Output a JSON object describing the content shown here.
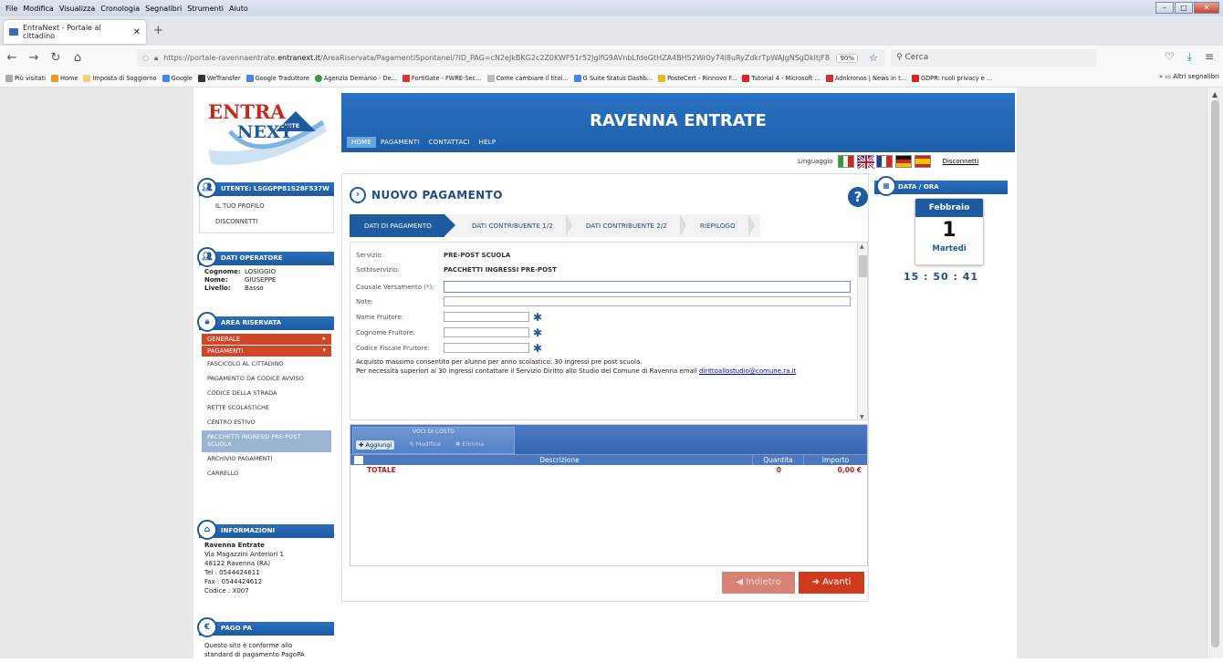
{
  "browser": {
    "menu": [
      "File",
      "Modifica",
      "Visualizza",
      "Cronologia",
      "Segnalibri",
      "Strumenti",
      "Aiuto"
    ],
    "tab_title": "EntraNext - Portale al cittadino",
    "url_prefix": "https://portale-ravennaentrate.",
    "url_domain": "entranext.it",
    "url_path": "/AreaRiservata/PagamentiSpontanei/?ID_PAG=cN2eJkBKG2c2Z0KWF51r52JglfG9AVnbLfdeGtHZA4BH52Wr0y74l8uRyZdkrTpWAJgNSgDkltjF8",
    "zoom": "90%",
    "search_placeholder": "Cerca",
    "bookmarks": [
      "Più visitati",
      "Home",
      "Imposta di Soggiorno",
      "Google",
      "WeTransfer",
      "Google Traduttore",
      "Agenzia Demanio - De...",
      "FortiGate - FWRE-Sec...",
      "Come cambiare il titol...",
      "G Suite Status Dashb...",
      "PosteCert - Rinnovo F...",
      "Tutorial 4 - Microsoft ...",
      "Adnkronos | News in t...",
      "GDPR: ruoli privacy e ..."
    ],
    "bookmarks_other": "Altri segnalibri"
  },
  "header": {
    "logo_line1": "ENTRA",
    "logo_suite": "SUITE",
    "logo_line2": "NEXT",
    "title": "RAVENNA ENTRATE",
    "menu": [
      "HOME",
      "PAGAMENTI",
      "CONTATTACI",
      "HELP"
    ],
    "language_label": "Linguaggio",
    "logout": "Disconnetti"
  },
  "sidebar": {
    "user_head": "UTENTE: LSGGPP81S28F537W",
    "user_links": [
      "IL TUO PROFILO",
      "DISCONNETTI"
    ],
    "operator_head": "DATI OPERATORE",
    "operator": [
      {
        "k": "Cognome:",
        "v": "LOSIGGIO"
      },
      {
        "k": "Nome:",
        "v": "GIUSEPPE"
      },
      {
        "k": "Livello:",
        "v": "Basso"
      }
    ],
    "reserved_head": "AREA RISERVATA",
    "sub_generale": "GENERALE",
    "sub_pagamenti": "PAGAMENTI",
    "items": [
      "FASCICOLO AL CITTADINO",
      "PAGAMENTO DA CODICE AVVISO",
      "CODICE DELLA STRADA",
      "RETTE SCOLASTICHE",
      "CENTRO ESTIVO",
      "PACCHETTI INGRESSI PRE-POST SCUOLA",
      "ARCHIVIO PAGAMENTI",
      "CARRELLO"
    ],
    "info_head": "INFORMAZIONI",
    "info_name": "Ravenna Entrate",
    "info_lines": [
      "Via Magazzini Anteriori 1",
      "48122 Ravenna (RA)",
      "Tel : 0544424611",
      "Fax : 0544424612",
      "Codice : X007"
    ],
    "pagopa_head": "PAGO PA",
    "pagopa_text1": "Questo sito è conforme allo",
    "pagopa_text2": "standard di pagamento PagoPA"
  },
  "main": {
    "title": "NUOVO PAGAMENTO",
    "help": "?",
    "steps": [
      "DATI DI PAGAMENTO",
      "DATI CONTRIBUENTE 1/2",
      "DATI CONTRIBUENTE 2/2",
      "RIEPILOGO"
    ],
    "servizio_label": "Servizio:",
    "servizio_value": "PRE-POST SCUOLA",
    "sotto_label": "Sottoservizio:",
    "sotto_value": "PACCHETTI INGRESSI PRE-POST",
    "causale_label": "Causale Versamento (*):",
    "note_label": "Note:",
    "nome_label": "Nome Fruitore:",
    "cognome_label": "Cognome Fruitore:",
    "cf_label": "Codice Fiscale Fruitore:",
    "notice1": "Acquisto massimo consentito per alunno per anno scolastico: 30 ingressi pre post scuola.",
    "notice2": "Per necessità superiori ai 30 ingressi contattare il Servizio Diritto allo Studio del Comune di Ravenna email",
    "notice_email": "dirittoallostudio@comune.ra.it",
    "costs_caption": "VOCI DI COSTO",
    "btn_add": "Aggiungi",
    "btn_edit": "Modifica",
    "btn_delete": "Elimina",
    "col_desc": "Descrizione",
    "col_qty": "Quantita",
    "col_amount": "Importo",
    "total_label": "TOTALE",
    "total_qty": "0",
    "total_amount": "0,00 €",
    "back": "Indietro",
    "next": "Avanti"
  },
  "date": {
    "head": "DATA / ORA",
    "month": "Febbraio",
    "day": "1",
    "weekday": "Martedì",
    "time": "15 : 50 : 41"
  }
}
